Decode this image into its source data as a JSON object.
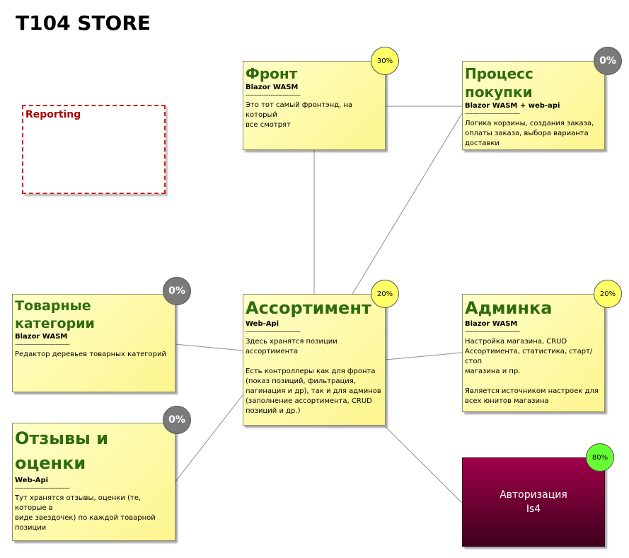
{
  "title": "T104 STORE",
  "colors": {
    "note_fill": "#fdf58e",
    "heading_green": "#2e6b0f",
    "badge_yellow": "#ffff66",
    "badge_gray": "#7a7a7a",
    "badge_green": "#66ff33",
    "auth_fill": "#8a0040",
    "reporting_border": "#d92020"
  },
  "separator": "-------------------------------",
  "nodes": {
    "front": {
      "heading": "Фронт",
      "sub": "Blazor WASM",
      "desc": "Это тот самый фронтэнд, на который\nвсе смотрят",
      "badge": "30%"
    },
    "purchase": {
      "heading": "Процесс покупки",
      "sub": "Blazor WASM + web-api",
      "desc": "Логика корзины, создания заказа,\nоплаты заказа, выбора варианта\nдоставки",
      "badge": "0%"
    },
    "categories": {
      "heading": "Товарные категории",
      "sub": "Blazor WASM",
      "desc": "Редактор деревьев товарных категорий",
      "badge": "0%"
    },
    "assortment": {
      "heading": "Ассортимент",
      "sub": "Web-Api",
      "desc": "Здесь хранятся позиции ассортимента\n\nЕсть контроллеры как для фронта\n(показ позиций, фильтрация,\nпагинация и др), так и для админов\n(заполнение ассортимента, CRUD\nпозиций и др.)",
      "badge": "20%"
    },
    "admin": {
      "heading": "Админка",
      "sub": "Blazor WASM",
      "desc": "Настройка магазина, CRUD\nАссортимента, статистика, старт/стоп\nмагазина  и пр.\n\nЯвляется источником настроек для\nвсех юнитов магазина",
      "badge": "20%"
    },
    "reviews": {
      "heading": "Отзывы и\nоценки",
      "sub": "Web-Api",
      "desc": "Тут хранятся отзывы, оценки (те, которые в\nвиде звездочек) по каждой товарной\nпозиции",
      "badge": "0%"
    }
  },
  "reporting": {
    "label": "Reporting"
  },
  "auth": {
    "line1": "Авторизация",
    "line2": "Is4",
    "badge": "80%"
  }
}
